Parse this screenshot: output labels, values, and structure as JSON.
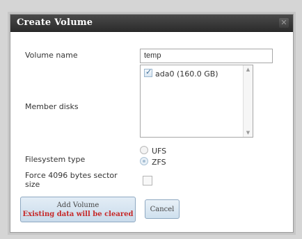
{
  "dialog": {
    "title": "Create Volume",
    "close_icon": "close-icon"
  },
  "form": {
    "volume_name": {
      "label": "Volume name",
      "value": "temp"
    },
    "member_disks": {
      "label": "Member disks",
      "items": [
        {
          "label": "ada0 (160.0 GB)",
          "checked": true
        }
      ]
    },
    "filesystem_type": {
      "label": "Filesystem type",
      "options": [
        {
          "label": "UFS",
          "selected": false
        },
        {
          "label": "ZFS",
          "selected": true
        }
      ]
    },
    "force_4096": {
      "label_line1": "Force 4096 bytes sector",
      "label_line2": "size",
      "checked": false
    }
  },
  "buttons": {
    "add_volume": {
      "label": "Add Volume",
      "warning": "Existing data will be cleared"
    },
    "cancel": {
      "label": "Cancel"
    }
  }
}
